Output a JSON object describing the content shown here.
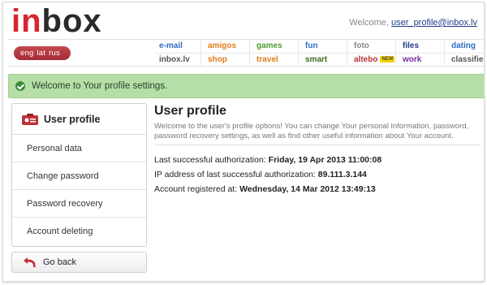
{
  "header": {
    "logo_part1": "in",
    "logo_part2": "box",
    "welcome_text": "Welcome, ",
    "welcome_user": "user_profile@inbox.lv"
  },
  "languages": [
    "eng",
    "lat",
    "rus"
  ],
  "nav": {
    "row1": [
      {
        "label": "e-mail",
        "color": "#2b6dc7"
      },
      {
        "label": "amigos",
        "color": "#e07b18"
      },
      {
        "label": "games",
        "color": "#4b9c2a"
      },
      {
        "label": "fun",
        "color": "#2b6dc7"
      },
      {
        "label": "foto",
        "color": "#888888"
      },
      {
        "label": "files",
        "color": "#1f3c8a"
      },
      {
        "label": "dating",
        "color": "#2b6dc7"
      }
    ],
    "row2": [
      {
        "label": "inbox.lv",
        "color": "#555555"
      },
      {
        "label": "shop",
        "color": "#e07b18"
      },
      {
        "label": "travel",
        "color": "#e07b18"
      },
      {
        "label": "smart",
        "color": "#3d6b20"
      },
      {
        "label": "altebo",
        "color": "#c0303a",
        "badge": "NEW"
      },
      {
        "label": "work",
        "color": "#7a2a9c"
      },
      {
        "label": "classifieds",
        "color": "#555555"
      }
    ]
  },
  "banner": {
    "message": "Welcome to Your profile settings."
  },
  "sidebar": {
    "title": "User profile",
    "items": [
      {
        "label": "Personal data"
      },
      {
        "label": "Change password"
      },
      {
        "label": "Password recovery"
      },
      {
        "label": "Account deleting"
      }
    ],
    "back_label": "Go back"
  },
  "main": {
    "title": "User profile",
    "description": "Welcome to the user's profile options! You can change Your personal information, password, password recovery settings, as well as find other useful information about Your account.",
    "last_auth_label": "Last successful authorization: ",
    "last_auth_value": "Friday, 19 Apr 2013 11:00:08",
    "ip_label": "IP address of last successful authorization: ",
    "ip_value": "89.111.3.144",
    "registered_label": "Account registered at: ",
    "registered_value": "Wednesday, 14 Mar 2012 13:49:13"
  },
  "colors": {
    "brand_red": "#d6262f",
    "banner_green": "#b6dfa7"
  }
}
